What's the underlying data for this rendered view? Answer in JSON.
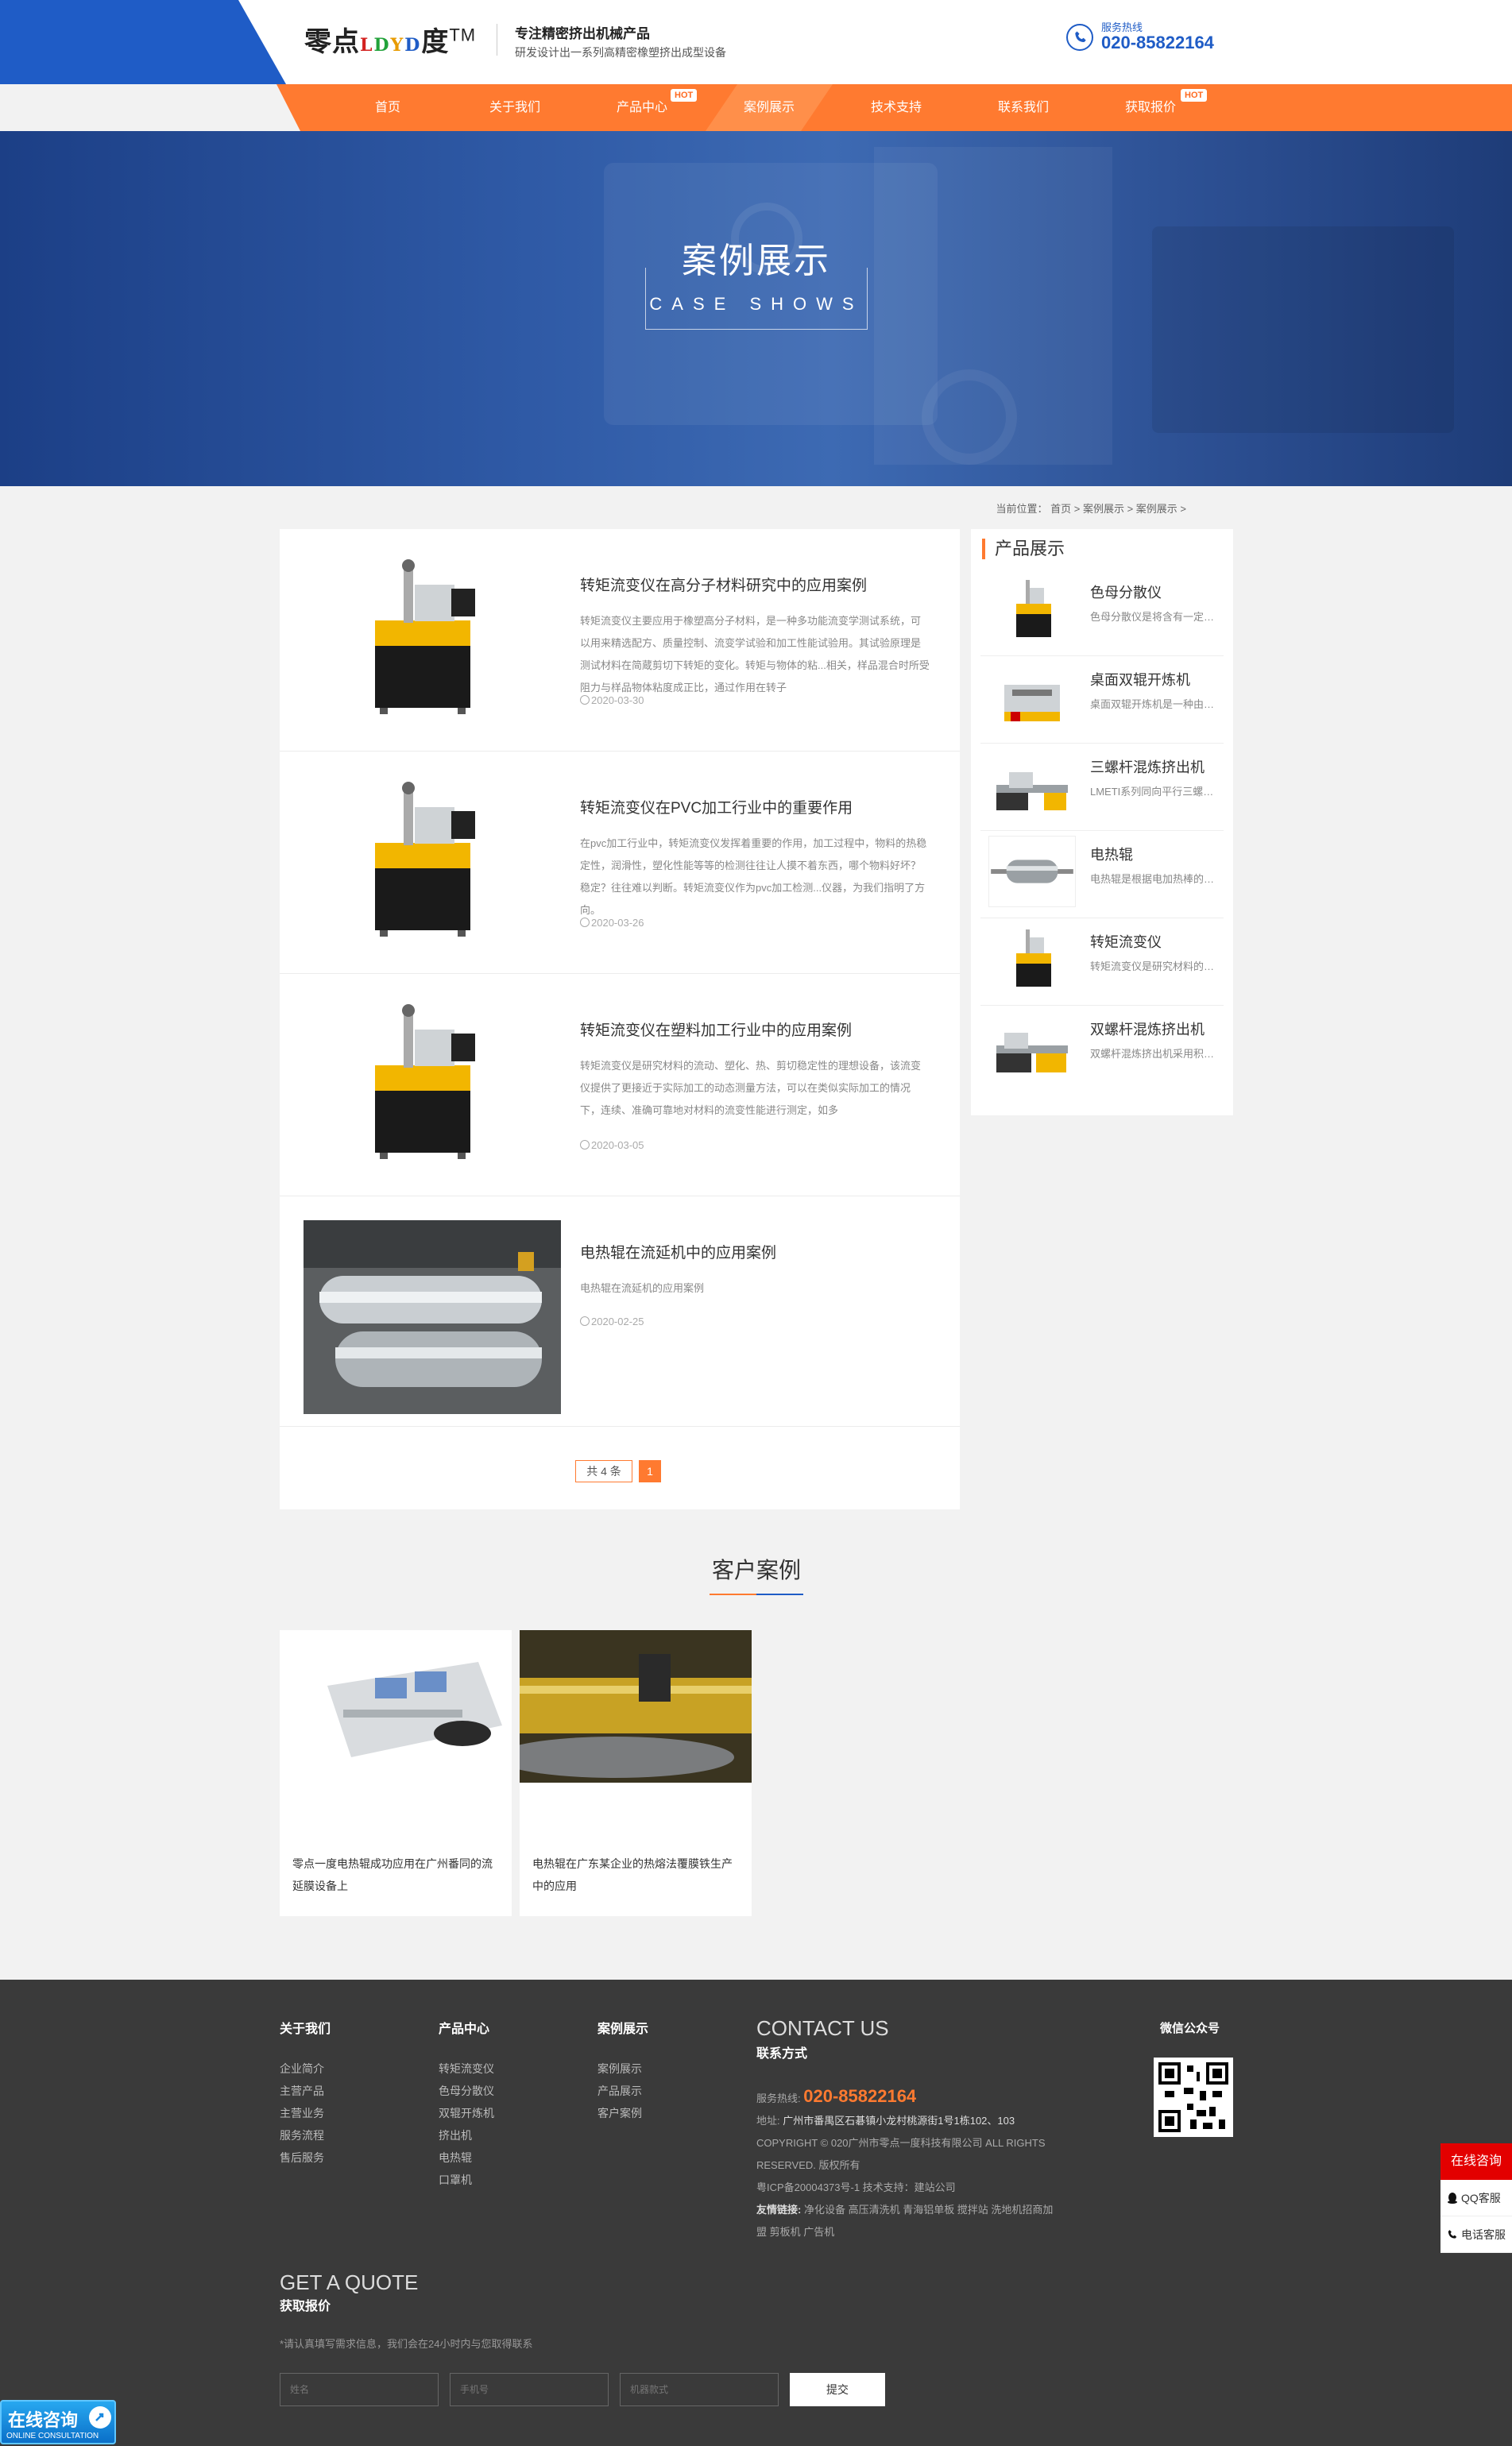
{
  "header": {
    "logo": {
      "part1": "零点",
      "mid": [
        "L",
        "D",
        "Y",
        "D"
      ],
      "part2": "度",
      "tm": "TM"
    },
    "slogan_main": "专注精密挤出机械产品",
    "slogan_sub": "研发设计出一系列高精密橡塑挤出成型设备",
    "hotline_label": "服务热线",
    "hotline_number": "020-85822164",
    "brand_blue": "#1f5cc6",
    "accent_orange": "#ff7a30"
  },
  "nav": {
    "items": [
      {
        "label": "首页",
        "hot": false
      },
      {
        "label": "关于我们",
        "hot": false
      },
      {
        "label": "产品中心",
        "hot": true
      },
      {
        "label": "案例展示",
        "hot": false,
        "active": true
      },
      {
        "label": "技术支持",
        "hot": false
      },
      {
        "label": "联系我们",
        "hot": false
      },
      {
        "label": "获取报价",
        "hot": true
      }
    ],
    "hot_label": "HOT"
  },
  "banner": {
    "title": "案例展示",
    "subtitle": "CASE SHOWS"
  },
  "breadcrumb": "当前位置： 首页 > 案例展示 > 案例展示 >",
  "cases": [
    {
      "title": "转矩流变仪在高分子材料研究中的应用案例",
      "desc": "转矩流变仪主要应用于橡塑高分子材料，是一种多功能流变学测试系统，可以用来精选配方、质量控制、流变学试验和加工性能试验用。其试验原理是测试材料在简蔵剪切下转矩的变化。转矩与物体的粘...相关，样品混合时所受阻力与样品物体粘度成正比，通过作用在转子",
      "date": "2020-03-30",
      "image": "rheometer"
    },
    {
      "title": "转矩流变仪在PVC加工行业中的重要作用",
      "desc": "在pvc加工行业中，转矩流变仪发挥着重要的作用，加工过程中，物料的热稳定性，润滑性，塑化性能等等的检测往往让人摸不着东西，哪个物料好坏？稳定？往往难以判断。转矩流变仪作为pvc加工检测...仪器，为我们指明了方向。",
      "date": "2020-03-26",
      "image": "rheometer"
    },
    {
      "title": "转矩流变仪在塑料加工行业中的应用案例",
      "desc": "转矩流变仪是研究材料的流动、塑化、热、剪切稳定性的理想设备，该流变仪提供了更接近于实际加工的动态测量方法，可以在类似实际加工的情况下，连续、准确可靠地对材料的流变性能进行测定，如多",
      "date": "2020-03-05",
      "image": "rheometer"
    },
    {
      "title": "电热辊在流延机中的应用案例",
      "desc": "电热辊在流延机的应用案例",
      "date": "2020-02-25",
      "image": "roller-photo"
    }
  ],
  "pager": {
    "total": "共 4 条",
    "current": "1"
  },
  "sidebar": {
    "title": "产品展示",
    "products": [
      {
        "name": "色母分散仪",
        "desc": "色母分散仪是将含有一定浓度的色母粒分散",
        "image": "small-rheometer"
      },
      {
        "name": "桌面双辊开炼机",
        "desc": "桌面双辊开炼机是一种由两个转速不同的辊筒",
        "image": "two-roll-mill"
      },
      {
        "name": "三螺杆混炼挤出机",
        "desc": "LMETI系列同向平行三螺杆混炼挤出机",
        "image": "extruder"
      },
      {
        "name": "电热辊",
        "desc": "电热辊是根据电加热棒的原理制作的",
        "image": "roller"
      },
      {
        "name": "转矩流变仪",
        "desc": "转矩流变仪是研究材料的流动塑化性能",
        "image": "small-rheometer"
      },
      {
        "name": "双螺杆混炼挤出机",
        "desc": "双螺杆混炼挤出机采用积木式结构设计",
        "image": "extruder"
      }
    ]
  },
  "customer_cases": {
    "title": "客户案例",
    "items": [
      {
        "text": "零点一度电热辊成功应用在广州番同的流延膜设备上",
        "image": "film-line"
      },
      {
        "text": "电热辊在广东某企业的热熔法覆膜铁生产中的应用",
        "image": "coating-line"
      }
    ]
  },
  "footer": {
    "columns": [
      {
        "title": "关于我们",
        "links": [
          "企业简介",
          "主营产品",
          "主营业务",
          "服务流程",
          "售后服务"
        ]
      },
      {
        "title": "产品中心",
        "links": [
          "转矩流变仪",
          "色母分散仪",
          "双辊开炼机",
          "挤出机",
          "电热辊",
          "口罩机"
        ]
      },
      {
        "title": "案例展示",
        "links": [
          "案例展示",
          "产品展示",
          "客户案例"
        ]
      }
    ],
    "contact": {
      "en": "CONTACT US",
      "cn": "联系方式",
      "hotline_label": "服务热线:",
      "hotline": "020-85822164",
      "address_label": "地址:",
      "address": "广州市番禺区石碁镇小龙村桃源街1号1栋102、103",
      "copyright": "COPYRIGHT © 020广州市零点一度科技有限公司 ALL RIGHTS RESERVED. 版权所有",
      "icp": "粤ICP备20004373号-1 技术支持：建站公司",
      "links_label": "友情链接:",
      "links": "净化设备  高压清洗机  青海铝单板  搅拌站  洗地机招商加盟  剪板机  广告机"
    },
    "wechat_label": "微信公众号",
    "quote": {
      "en": "GET A QUOTE",
      "cn": "获取报价",
      "tip": "*请认真填写需求信息，我们会在24小时内与您取得联系",
      "name_placeholder": "姓名",
      "phone_placeholder": "手机号",
      "model_placeholder": "机器款式",
      "submit": "提交"
    }
  },
  "float_bar": {
    "online": "在线咨询",
    "qq": "QQ客服",
    "phone": "电话客服"
  },
  "online_badge": {
    "cn": "在线咨询",
    "en": "ONLINE CONSULTATION"
  }
}
